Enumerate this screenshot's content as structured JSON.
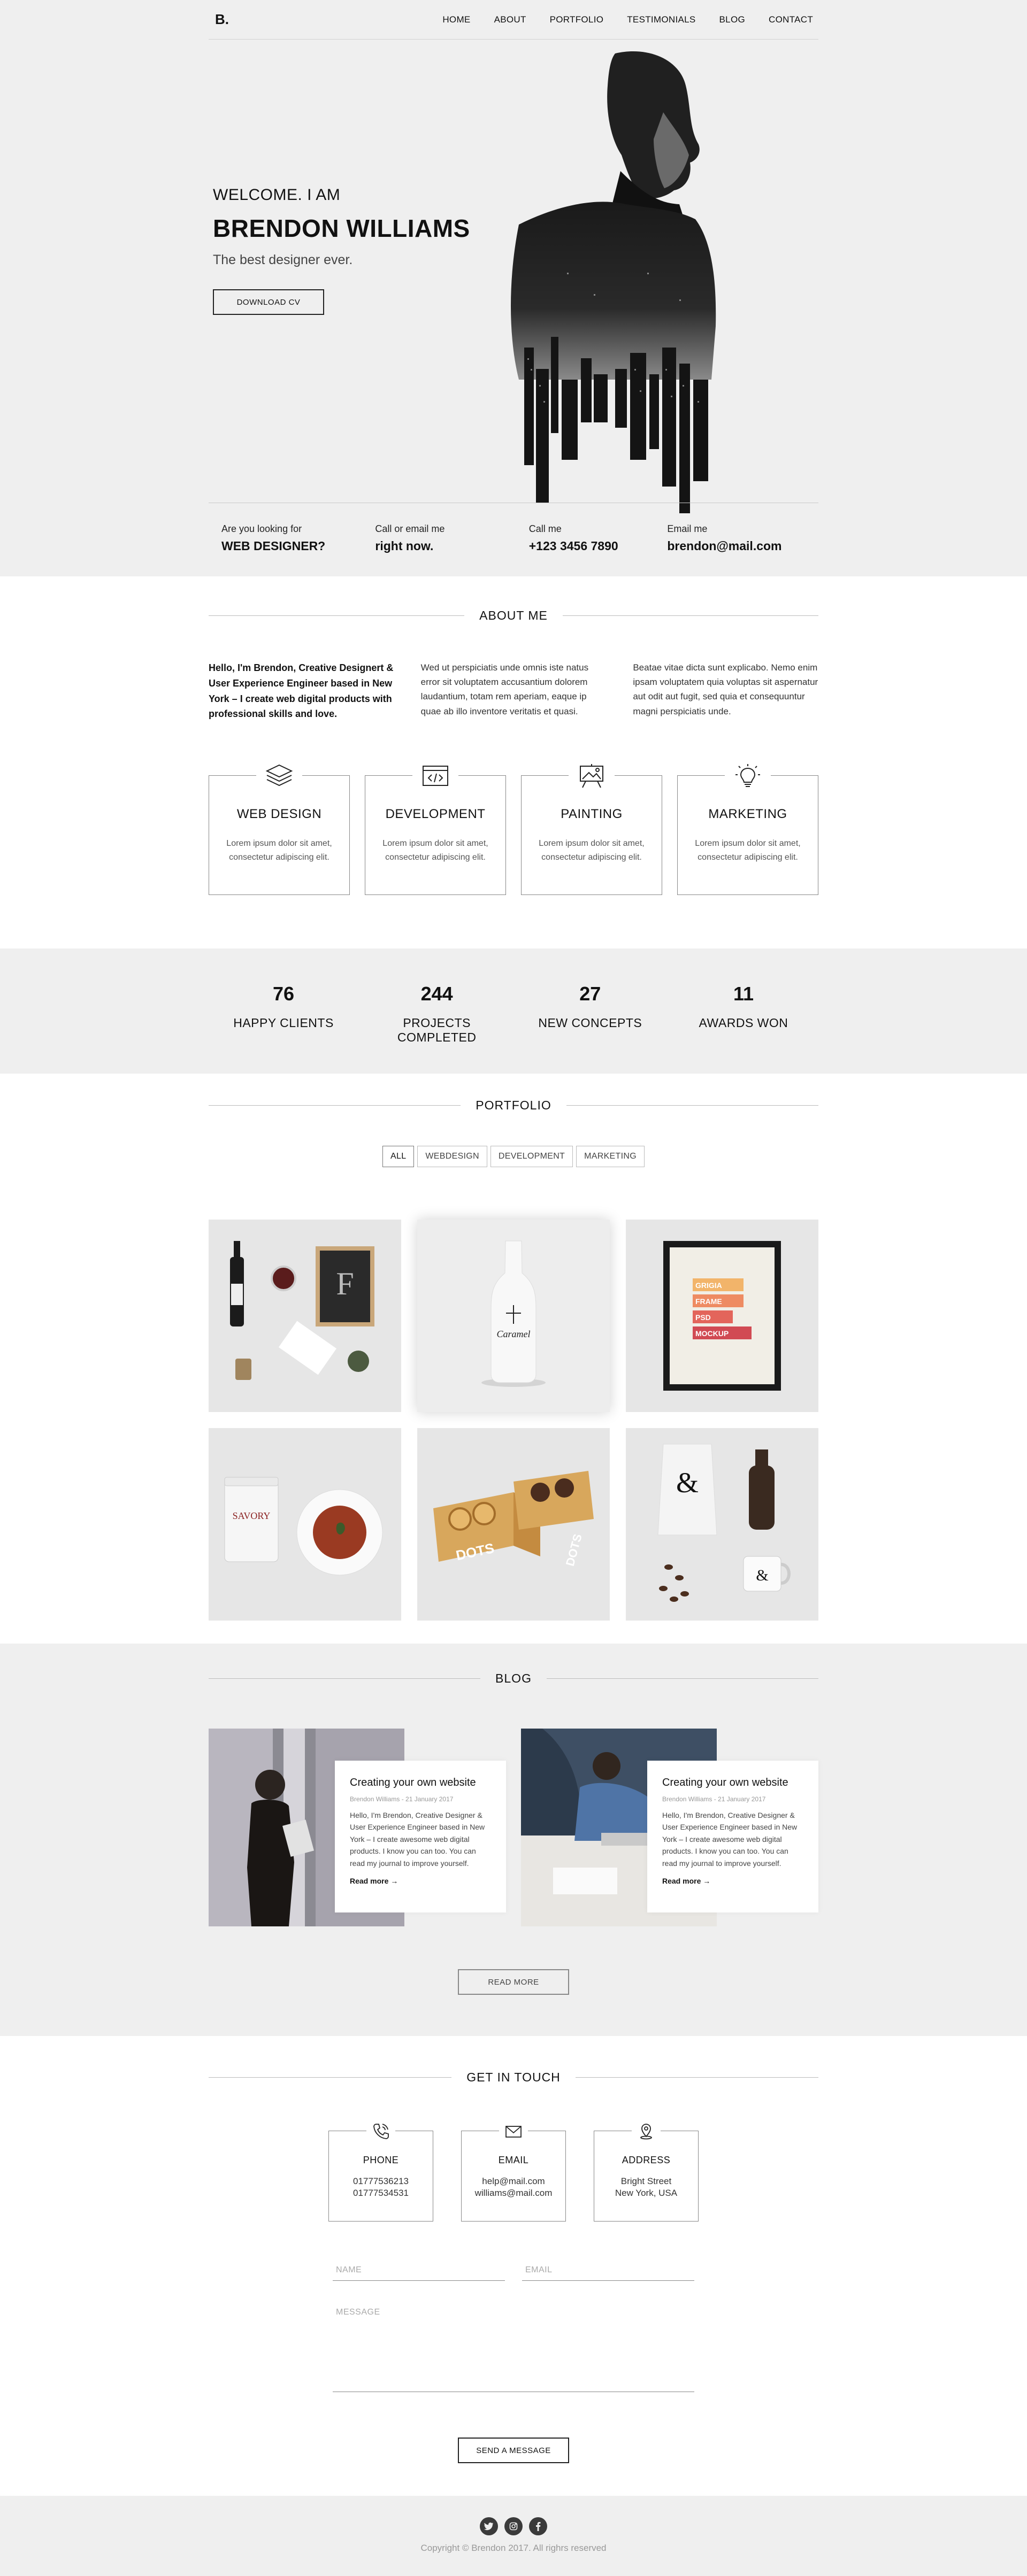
{
  "header": {
    "logo": "B.",
    "menu": [
      "HOME",
      "ABOUT",
      "PORTFOLIO",
      "TESTIMONIALS",
      "BLOG",
      "CONTACT"
    ]
  },
  "hero": {
    "welcome": "WELCOME. I AM",
    "name": "BRENDON WILLIAMS",
    "tagline": "The best designer ever.",
    "cta": "DOWNLOAD CV"
  },
  "contact_bar": [
    {
      "small": "Are you looking for",
      "big": "WEB DESIGNER?"
    },
    {
      "small": "Call or email me",
      "big": "right now."
    },
    {
      "small": "Call me",
      "big": "+123 3456 7890"
    },
    {
      "small": "Email me",
      "big": "brendon@mail.com"
    }
  ],
  "about": {
    "title": "ABOUT ME",
    "cols": [
      "Hello, I'm Brendon, Creative Designert & User Experience Engineer based in New York – I create web digital products with professional skills and love.",
      "Wed ut perspiciatis unde omnis iste natus error sit voluptatem accusantium dolorem laudantium, totam rem aperiam, eaque ip quae ab illo inventore veritatis et quasi.",
      "Beatae vitae dicta sunt explicabo. Nemo enim ipsam voluptatem quia voluptas sit aspernatur aut odit aut fugit, sed quia et consequuntur magni perspiciatis unde."
    ],
    "services": [
      {
        "title": "WEB DESIGN",
        "text": "Lorem ipsum dolor sit amet, consectetur adipiscing elit.",
        "icon": "layers-icon"
      },
      {
        "title": "DEVELOPMENT",
        "text": "Lorem ipsum dolor sit amet, consectetur adipiscing elit.",
        "icon": "code-window-icon"
      },
      {
        "title": "PAINTING",
        "text": "Lorem ipsum dolor sit amet, consectetur adipiscing elit.",
        "icon": "easel-icon"
      },
      {
        "title": "MARKETING",
        "text": "Lorem ipsum dolor sit amet, consectetur adipiscing elit.",
        "icon": "lightbulb-icon"
      }
    ]
  },
  "counters": [
    {
      "num": "76",
      "label": "HAPPY CLIENTS"
    },
    {
      "num": "244",
      "label": "PROJECTS COMPLETED"
    },
    {
      "num": "27",
      "label": "NEW CONCEPTS"
    },
    {
      "num": "11",
      "label": "AWARDS WON"
    }
  ],
  "portfolio": {
    "title": "PORTFOLIO",
    "filters": [
      "ALL",
      "WEBDESIGN",
      "DEVELOPMENT",
      "MARKETING"
    ],
    "active_filter": "ALL",
    "tiles": {
      "bottle_label": "Caramel",
      "frame_lines": [
        "GRIGIA",
        "FRAME",
        "PSD",
        "MOCKUP"
      ],
      "tin_label": "SAVORY",
      "box_label": "DOTS",
      "bag_mark": "&"
    }
  },
  "blog": {
    "title": "BLOG",
    "posts": [
      {
        "title": "Creating your own website",
        "meta": "Brendon Williams - 21 January 2017",
        "text": "Hello, I'm Brendon, Creative Designer & User Experience Engineer based in New York – I create awesome web digital products. I know you can too. You can read my journal to improve yourself.",
        "more": "Read more →"
      },
      {
        "title": "Creating your own website",
        "meta": "Brendon Williams - 21 January 2017",
        "text": "Hello, I'm Brendon, Creative Designer & User Experience Engineer based in New York – I create awesome web digital products. I know you can too. You can read my journal to improve yourself.",
        "more": "Read more →"
      }
    ],
    "cta": "READ MORE"
  },
  "contact": {
    "title": "GET IN TOUCH",
    "boxes": [
      {
        "title": "PHONE",
        "line1": "01777536213",
        "line2": "01777534531",
        "icon": "phone-icon"
      },
      {
        "title": "EMAIL",
        "line1": "help@mail.com",
        "line2": "williams@mail.com",
        "icon": "envelope-icon"
      },
      {
        "title": "ADDRESS",
        "line1": "Bright Street",
        "line2": "New York, USA",
        "icon": "location-pin-icon"
      }
    ],
    "form": {
      "name_placeholder": "NAME",
      "email_placeholder": "EMAIL",
      "message_placeholder": "MESSAGE",
      "submit": "SEND A MESSAGE"
    }
  },
  "footer": {
    "social": [
      "twitter-icon",
      "instagram-icon",
      "facebook-icon"
    ],
    "copyright": "Copyright © Brendon 2017. All righrs reserved"
  }
}
